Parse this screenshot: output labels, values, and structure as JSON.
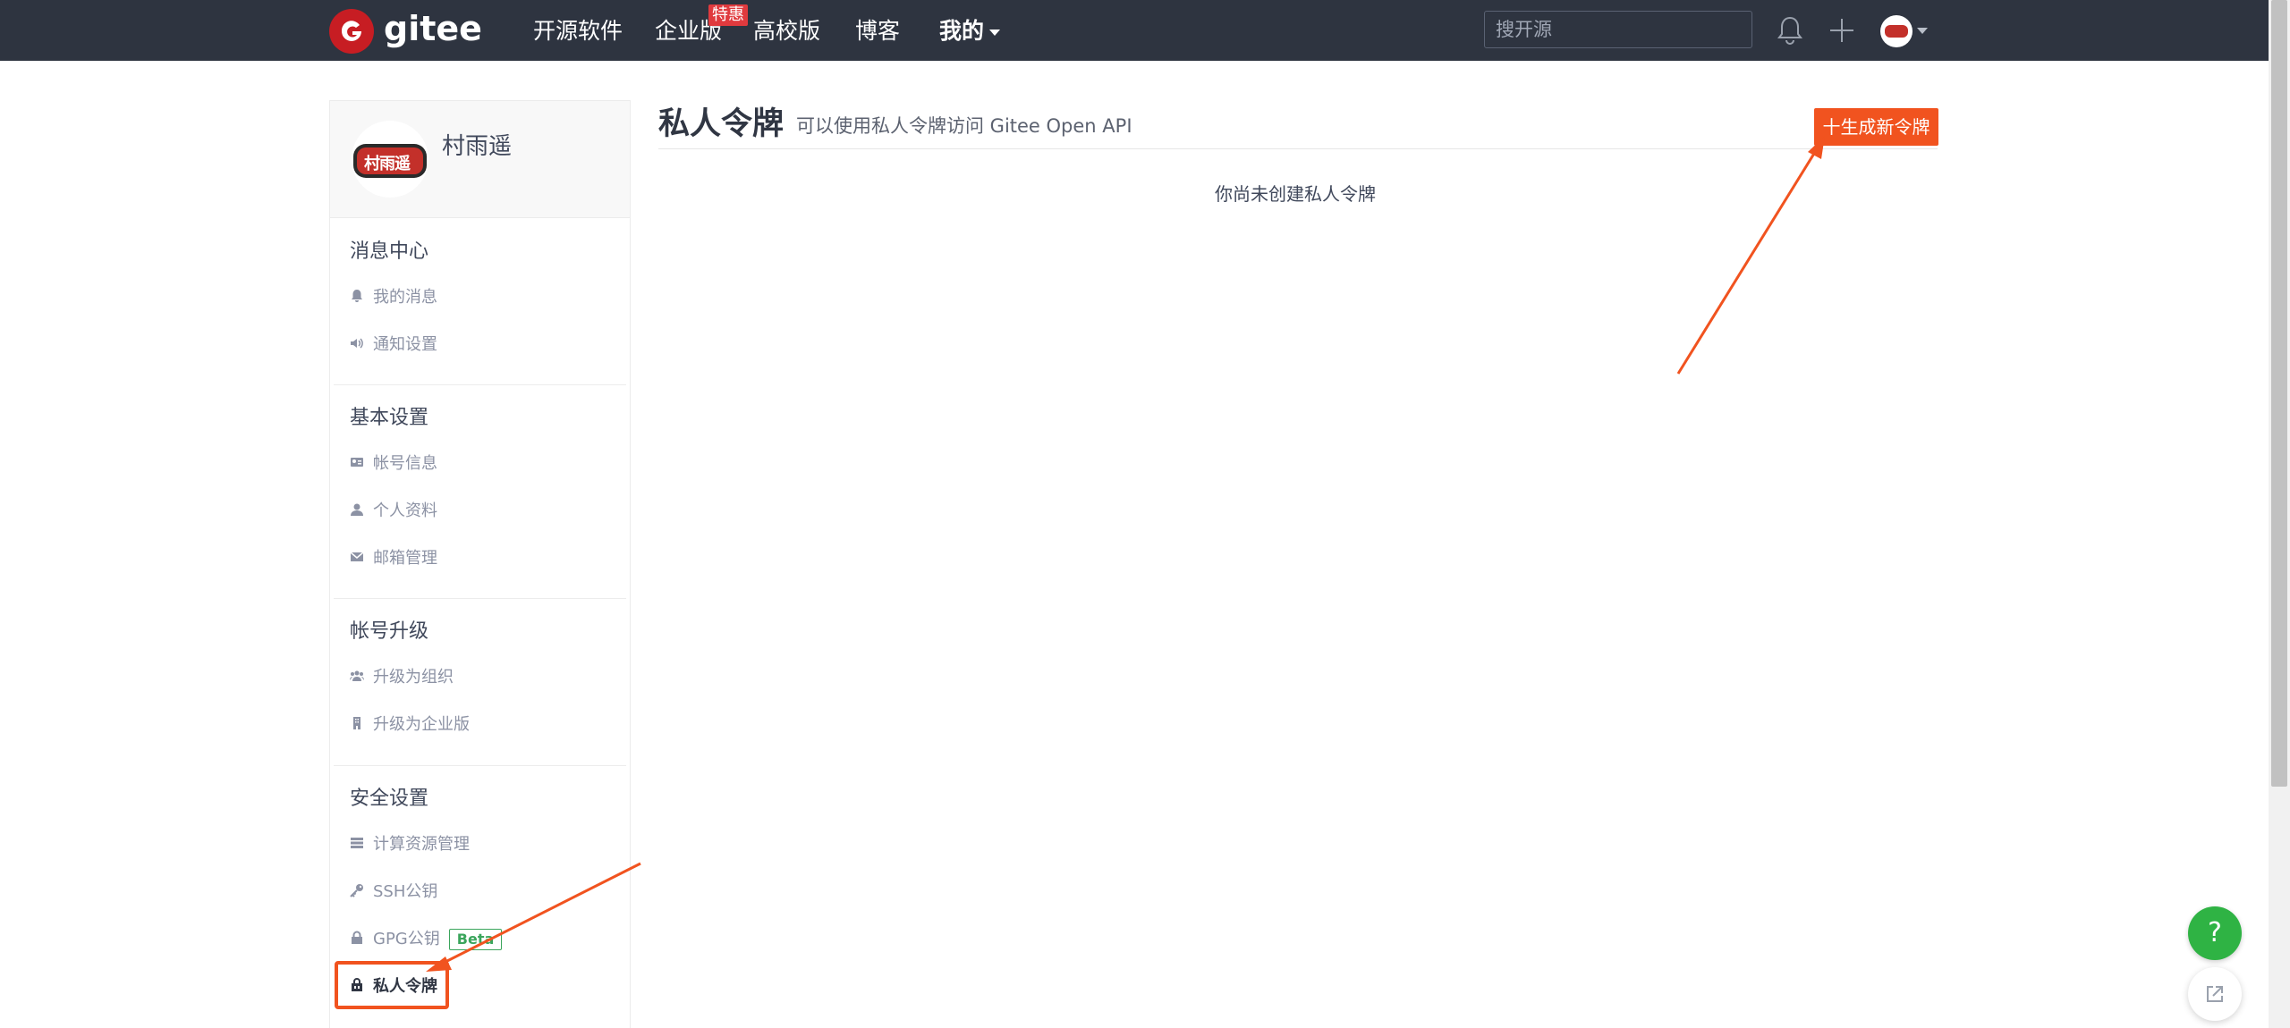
{
  "topnav": {
    "logo_text": "gitee",
    "items": [
      {
        "label": "开源软件"
      },
      {
        "label": "企业版"
      },
      {
        "label": "高校版"
      },
      {
        "label": "博客"
      },
      {
        "label": "我的"
      }
    ],
    "enterprise_badge": "特惠",
    "search_placeholder": "搜开源"
  },
  "sidebar": {
    "username": "村雨遥",
    "avatar_text": "村雨遥",
    "sections": [
      {
        "title": "消息中心",
        "items": [
          {
            "label": "我的消息",
            "icon": "bell-icon"
          },
          {
            "label": "通知设置",
            "icon": "speaker-icon"
          }
        ]
      },
      {
        "title": "基本设置",
        "items": [
          {
            "label": "帐号信息",
            "icon": "id-card-icon"
          },
          {
            "label": "个人资料",
            "icon": "user-icon"
          },
          {
            "label": "邮箱管理",
            "icon": "envelope-icon"
          }
        ]
      },
      {
        "title": "帐号升级",
        "items": [
          {
            "label": "升级为组织",
            "icon": "users-icon"
          },
          {
            "label": "升级为企业版",
            "icon": "building-icon"
          }
        ]
      },
      {
        "title": "安全设置",
        "items": [
          {
            "label": "计算资源管理",
            "icon": "server-icon"
          },
          {
            "label": "SSH公钥",
            "icon": "key-icon"
          },
          {
            "label": "GPG公钥",
            "icon": "lock-icon",
            "badge": "Beta"
          },
          {
            "label": "私人令牌",
            "icon": "token-icon",
            "active": true
          }
        ]
      }
    ]
  },
  "main": {
    "title": "私人令牌",
    "subtitle": "可以使用私人令牌访问 Gitee Open API",
    "new_token_button": "十生成新令牌",
    "empty_message": "你尚未创建私人令牌"
  },
  "floating": {
    "help_label": "?"
  },
  "colors": {
    "nav_bg": "#2e3440",
    "brand_red": "#c71d23",
    "accent_orange": "#f1531f",
    "help_green": "#2fb344",
    "beta_green": "#3ba55c"
  }
}
